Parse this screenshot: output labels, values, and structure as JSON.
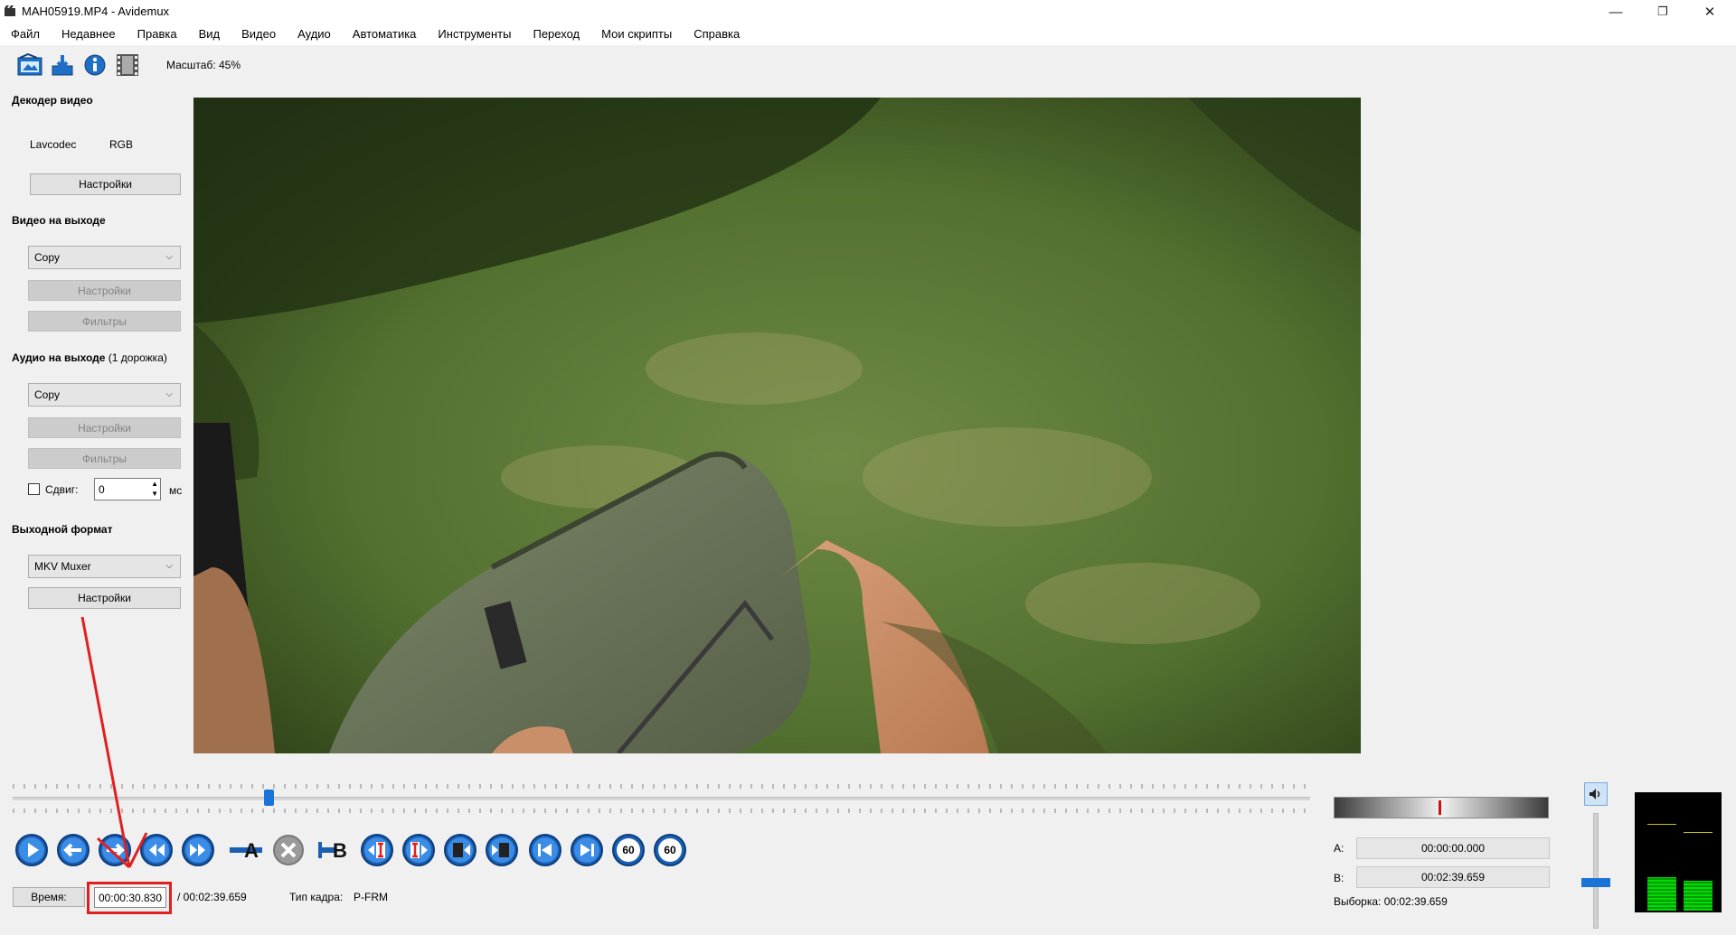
{
  "window": {
    "title": "MAH05919.MP4 - Avidemux",
    "controls": [
      "—",
      "❐",
      "✕"
    ]
  },
  "menu": [
    "Файл",
    "Недавнее",
    "Правка",
    "Вид",
    "Видео",
    "Аудио",
    "Автоматика",
    "Инструменты",
    "Переход",
    "Мои скрипты",
    "Справка"
  ],
  "toolbar": {
    "icons": [
      "open-folder-icon",
      "save-icon",
      "info-icon",
      "film-strip-icon"
    ],
    "zoom_label": "Масштаб: 45%"
  },
  "left_panel": {
    "video_decoder": {
      "title": "Декодер видео",
      "decoder": "Lavcodec",
      "colorspace": "RGB",
      "settings_label": "Настройки"
    },
    "video_output": {
      "title": "Видео на выходе",
      "codec": "Copy",
      "settings_label": "Настройки",
      "filters_label": "Фильтры"
    },
    "audio_output": {
      "title": "Аудио на выходе",
      "track_note": "(1 дорожка)",
      "codec": "Copy",
      "settings_label": "Настройки",
      "filters_label": "Фильтры",
      "shift_label": "Сдвиг:",
      "shift_value": "0",
      "shift_unit": "мс"
    },
    "output_format": {
      "title": "Выходной формат",
      "muxer": "MKV Muxer",
      "settings_label": "Настройки"
    }
  },
  "timeline": {
    "position_fraction": 0.197
  },
  "navigation": {
    "buttons": [
      "play",
      "prev-frame",
      "next-frame",
      "rewind",
      "fast-forward",
      "set-marker-a",
      "delete",
      "set-marker-b",
      "prev-cut",
      "next-cut",
      "prev-keyframe",
      "next-keyframe",
      "go-start",
      "go-end",
      "back-60",
      "forward-60"
    ],
    "label_60": "60"
  },
  "status": {
    "time_button": "Время:",
    "current_time": "00:00:30.830",
    "total_time": "/ 00:02:39.659",
    "frame_type_label": "Тип кадра:",
    "frame_type_value": "P-FRM"
  },
  "selection": {
    "a_label": "A:",
    "a_value": "00:00:00.000",
    "b_label": "B:",
    "b_value": "00:02:39.659",
    "selection_label": "Выборка: 00:02:39.659"
  },
  "audio": {
    "volume_icon": "speaker-icon",
    "volume_fraction": 0.6,
    "meter_colors": {
      "bar": "#00dd00",
      "background": "#000000"
    }
  },
  "colors": {
    "highlight": "#e02020",
    "accent": "#1a74d8"
  }
}
